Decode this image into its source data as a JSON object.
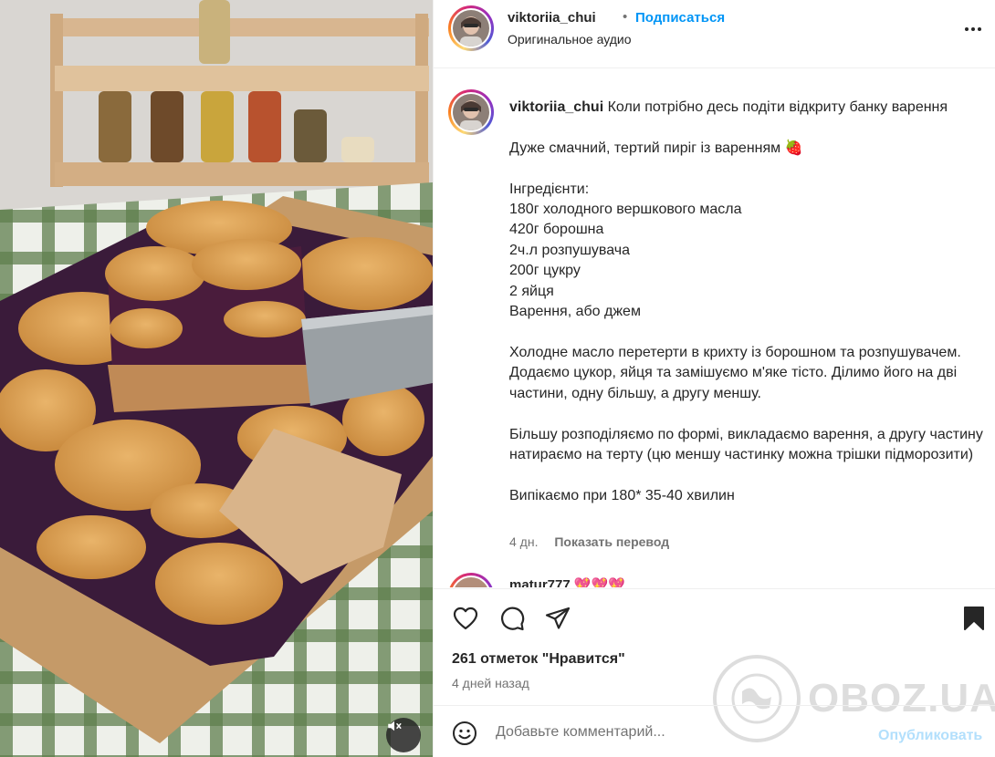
{
  "media": {
    "mute_icon": "speaker-muted-icon"
  },
  "header": {
    "username": "viktoriia_chui",
    "separator": "•",
    "follow_label": "Подписаться",
    "audio_label": "Оригинальное аудио",
    "more_icon": "more-options-icon"
  },
  "caption": {
    "username": "viktoriia_chui",
    "lines": [
      "Коли потрібно десь подіти відкриту банку варення",
      "",
      "Дуже смачний, тертий пиріг із варенням 🍓",
      "",
      "Інгредієнти:",
      "180г холодного вершкового масла",
      "420г борошна",
      "2ч.л розпушувача",
      "200г цукру",
      "2 яйця",
      "Варення, або джем",
      "",
      "Холодне масло перетерти в крихту із борошном та розпушувачем. Додаємо цукор, яйця та замішуємо м'яке тісто. Ділимо його на дві частини, одну більшу, а другу меншу.",
      "",
      "Більшу розподіляємо по формі, викладаємо варення, а другу частину натираємо на терту (цю меншу частинку можна трішки підморозити)",
      "",
      "Випікаємо при 180* 35-40 хвилин"
    ],
    "age": "4 дн.",
    "translate_label": "Показать перевод"
  },
  "next_comment": {
    "text": "matur777 💖💖💖"
  },
  "actions": {
    "like_icon": "heart-icon",
    "comment_icon": "comment-icon",
    "share_icon": "share-icon",
    "save_icon": "bookmark-icon",
    "likes_text": "261 отметок \"Нравится\"",
    "date_text": "4 дней назад"
  },
  "watermark": {
    "text": "OBOZ.UA"
  },
  "comment_bar": {
    "emoji_icon": "emoji-icon",
    "placeholder": "Добавьте комментарий...",
    "publish_label": "Опубликовать"
  },
  "colors": {
    "accent": "#0095f6",
    "text": "#262626",
    "muted": "#737373",
    "publish_disabled": "#b2dffc"
  }
}
